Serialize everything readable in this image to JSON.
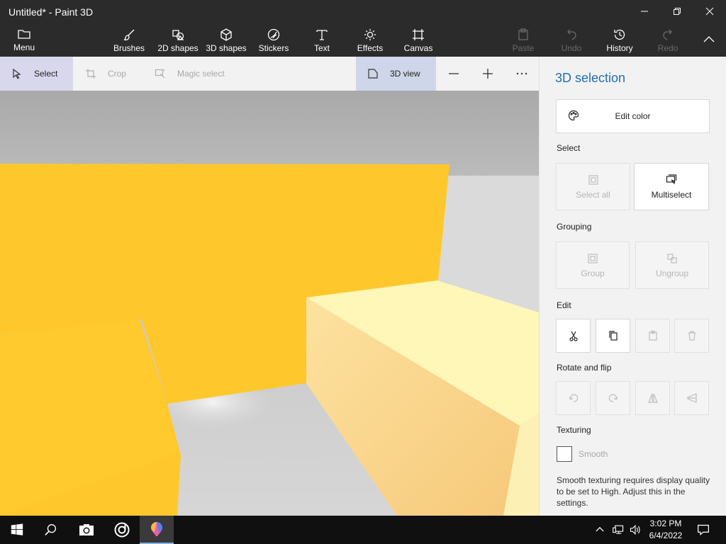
{
  "window": {
    "title": "Untitled* - Paint 3D",
    "minimize_icon": "minimize-icon",
    "maximize_icon": "restore-icon",
    "close_icon": "close-icon"
  },
  "ribbon": {
    "menu_label": "Menu",
    "tabs": [
      {
        "label": "Brushes",
        "icon": "brush-icon"
      },
      {
        "label": "2D shapes",
        "icon": "2d-shapes-icon"
      },
      {
        "label": "3D shapes",
        "icon": "3d-cube-icon"
      },
      {
        "label": "Stickers",
        "icon": "sticker-icon"
      },
      {
        "label": "Text",
        "icon": "text-icon"
      },
      {
        "label": "Effects",
        "icon": "sun-icon"
      },
      {
        "label": "Canvas",
        "icon": "canvas-icon"
      }
    ],
    "actions": [
      {
        "label": "Paste",
        "enabled": false
      },
      {
        "label": "Undo",
        "enabled": false
      },
      {
        "label": "History",
        "enabled": true
      },
      {
        "label": "Redo",
        "enabled": false
      }
    ]
  },
  "toolbar": {
    "select_label": "Select",
    "crop_label": "Crop",
    "magic_select_label": "Magic select",
    "view3d_label": "3D view"
  },
  "panel": {
    "title": "3D selection",
    "edit_color_label": "Edit color",
    "select_heading": "Select",
    "select_all_label": "Select all",
    "multiselect_label": "Multiselect",
    "grouping_heading": "Grouping",
    "group_label": "Group",
    "ungroup_label": "Ungroup",
    "edit_heading": "Edit",
    "rotate_heading": "Rotate and flip",
    "texturing_heading": "Texturing",
    "smooth_label": "Smooth",
    "smooth_checked": false,
    "note": "Smooth texturing requires display quality to be set to High. Adjust this in the settings."
  },
  "taskbar": {
    "time": "3:02 PM",
    "date": "6/4/2022"
  },
  "colors": {
    "chrome": "#2b2b2b",
    "accent": "#1e6fb8",
    "yellow": "#fec82d",
    "cream": "#fef7b8"
  }
}
